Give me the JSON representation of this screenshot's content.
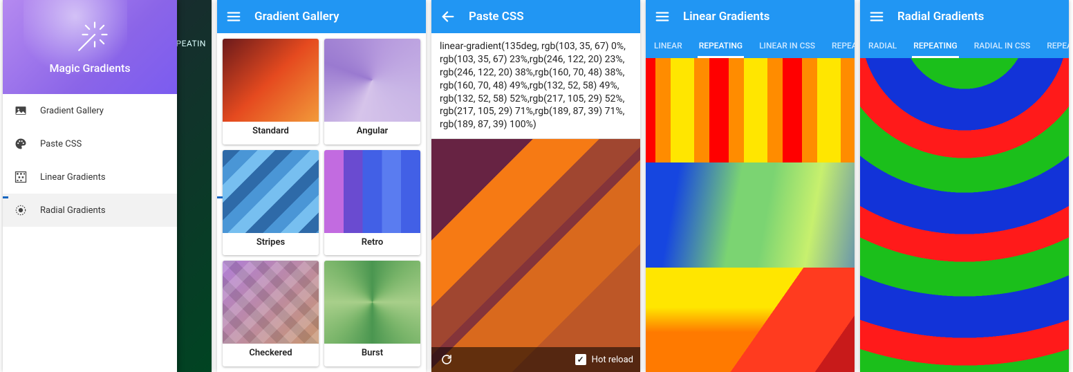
{
  "app_name": "Magic Gradients",
  "screens": {
    "drawer": {
      "bg_tabs_peek": "REPEATIN",
      "title": "Magic Gradients",
      "items": [
        {
          "icon": "image-icon",
          "label": "Gradient Gallery",
          "selected": false
        },
        {
          "icon": "palette-icon",
          "label": "Paste CSS",
          "selected": false
        },
        {
          "icon": "pattern-icon",
          "label": "Linear Gradients",
          "selected": false
        },
        {
          "icon": "target-icon",
          "label": "Radial Gradients",
          "selected": true
        }
      ]
    },
    "gallery": {
      "title": "Gradient Gallery",
      "cards": [
        {
          "label": "Standard",
          "swatch": "sw-standard"
        },
        {
          "label": "Angular",
          "swatch": "sw-angular"
        },
        {
          "label": "Stripes",
          "swatch": "sw-stripes"
        },
        {
          "label": "Retro",
          "swatch": "sw-retro"
        },
        {
          "label": "Checkered",
          "swatch": "sw-checkered"
        },
        {
          "label": "Burst",
          "swatch": "sw-burst"
        }
      ]
    },
    "paste_css": {
      "title": "Paste CSS",
      "css": "linear-gradient(135deg, rgb(103, 35, 67) 0%, rgb(103, 35, 67) 23%,rgb(246, 122, 20) 23%, rgb(246, 122, 20) 38%,rgb(160, 70, 48) 38%, rgb(160, 70, 48) 49%,rgb(132, 52, 58) 49%, rgb(132, 52, 58) 52%,rgb(217, 105, 29) 52%, rgb(217, 105, 29) 71%,rgb(189, 87, 39) 71%, rgb(189, 87, 39) 100%)",
      "hot_reload_label": "Hot reload",
      "hot_reload_checked": true
    },
    "linear": {
      "title": "Linear Gradients",
      "tabs": [
        "LINEAR",
        "REPEATING",
        "LINEAR IN CSS",
        "REPEATI"
      ],
      "active_tab": 1
    },
    "radial": {
      "title": "Radial Gradients",
      "tabs": [
        "RADIAL",
        "REPEATING",
        "RADIAL IN CSS",
        "REPEATI"
      ],
      "active_tab": 1
    }
  }
}
